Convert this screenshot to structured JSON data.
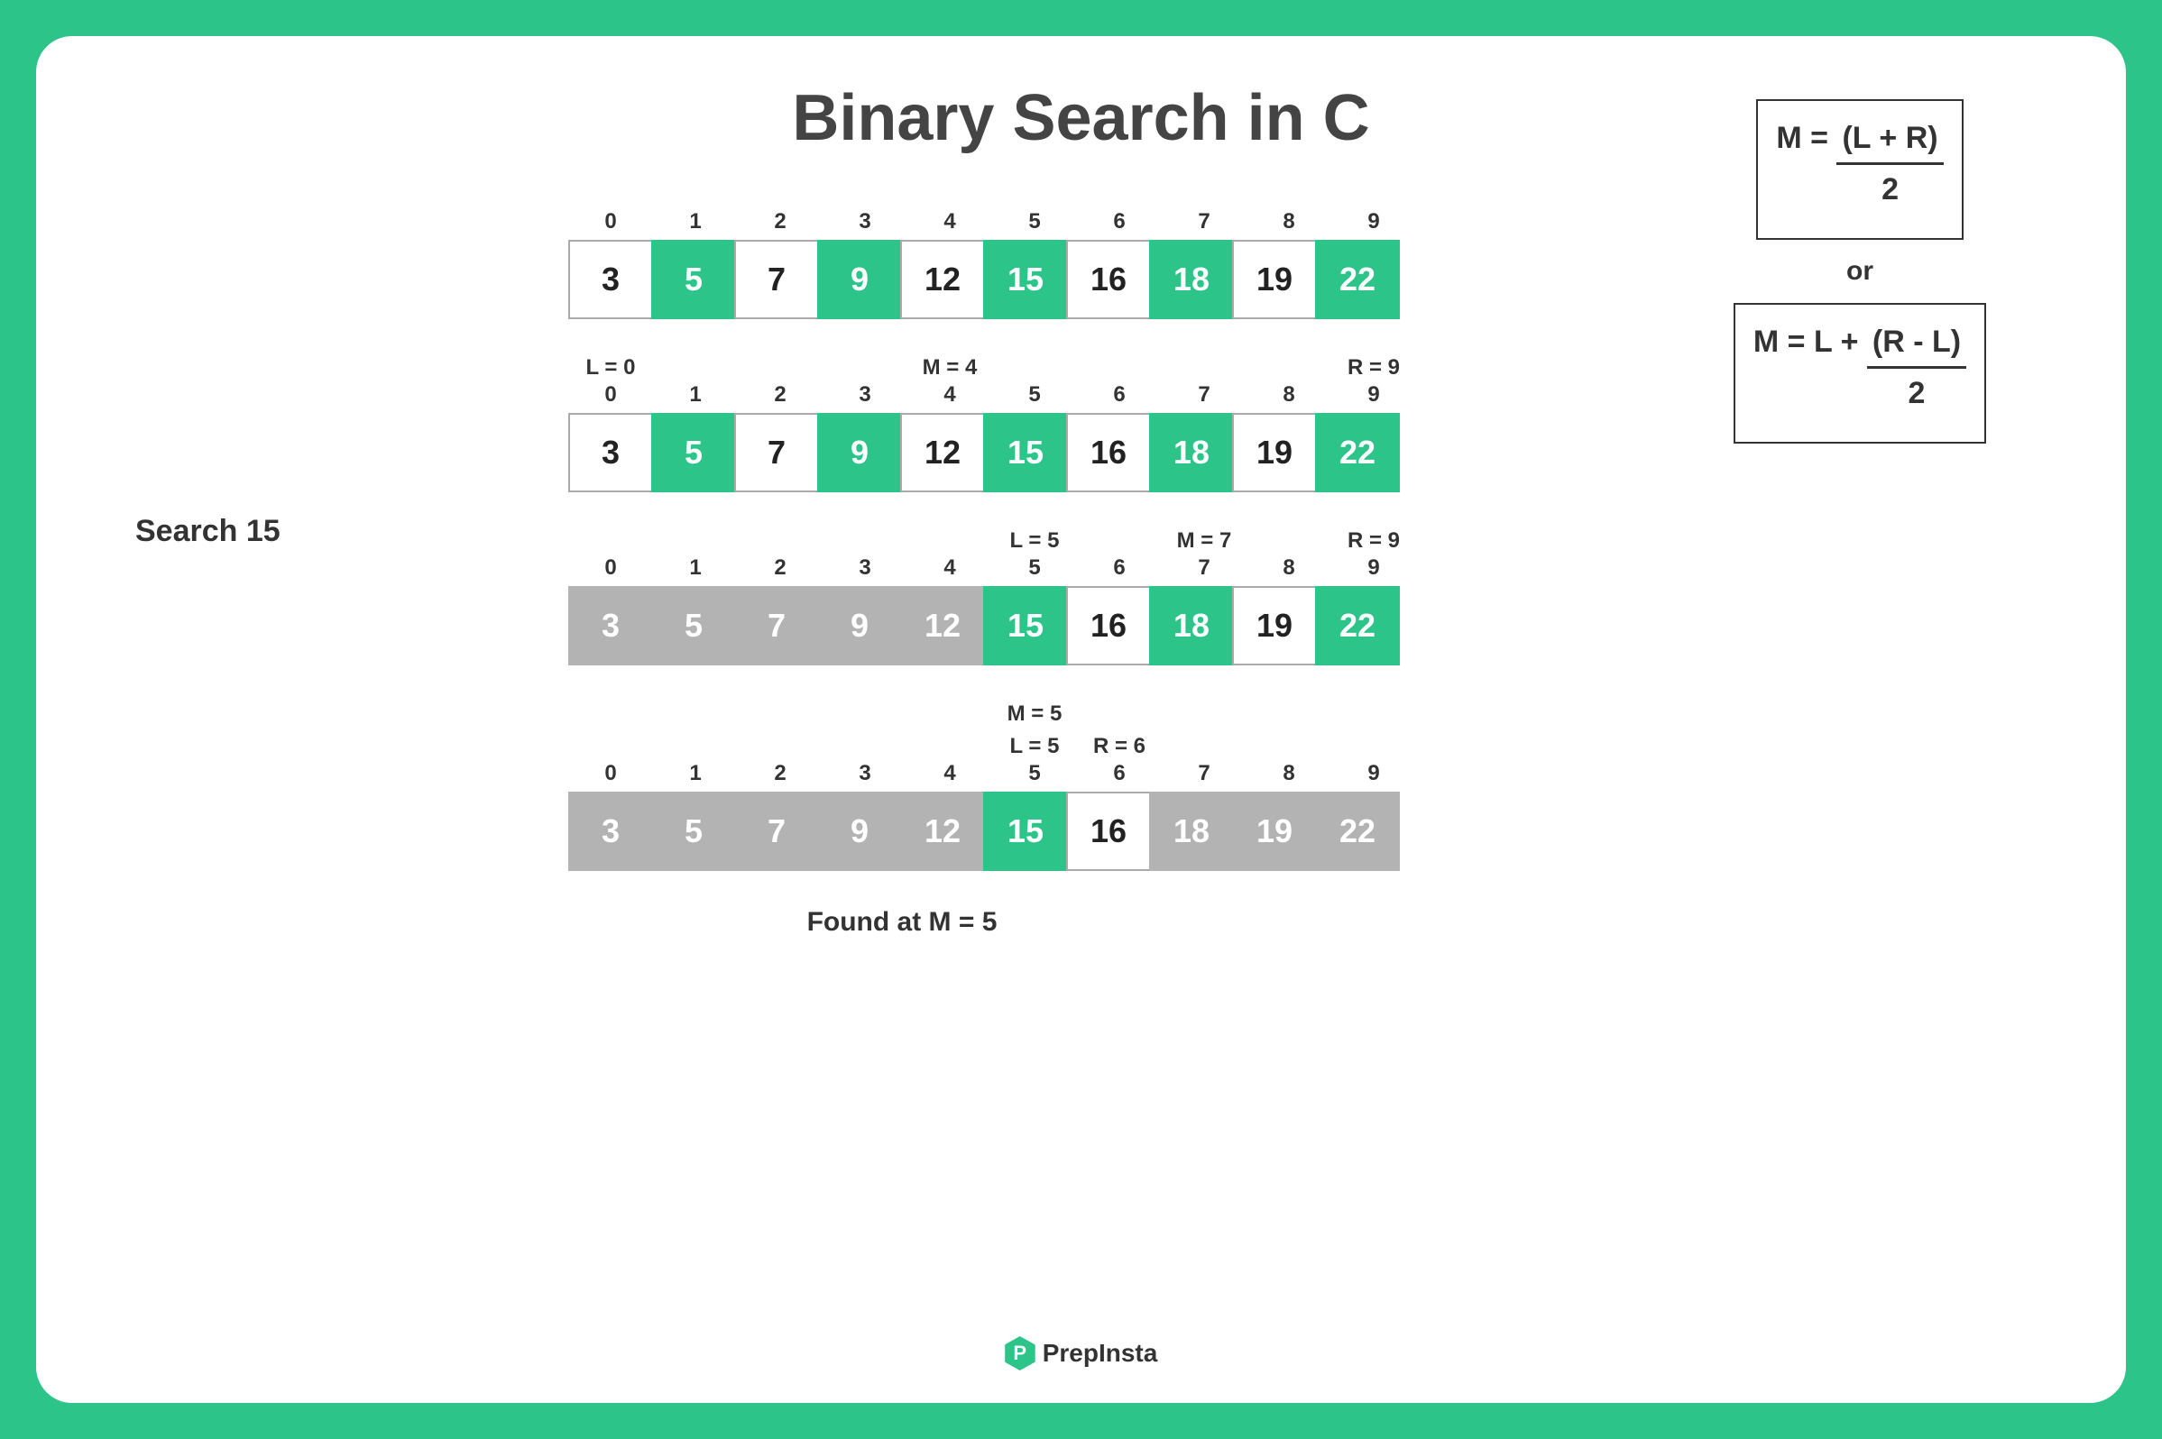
{
  "title": "Binary Search in C",
  "search_label": "Search 15",
  "formula": {
    "f1_lhs": "M = ",
    "f1_num": "(L + R)",
    "f1_den": "2",
    "or": "or",
    "f2_lhs": "M = L + ",
    "f2_num": "(R - L)",
    "f2_den": "2"
  },
  "indices": [
    "0",
    "1",
    "2",
    "3",
    "4",
    "5",
    "6",
    "7",
    "8",
    "9"
  ],
  "values": [
    "3",
    "5",
    "7",
    "9",
    "12",
    "15",
    "16",
    "18",
    "19",
    "22"
  ],
  "steps": [
    {
      "pointers_above": null,
      "pointers_below": null,
      "colors": [
        "white",
        "green",
        "white",
        "green",
        "white",
        "green",
        "white",
        "green",
        "white",
        "green"
      ]
    },
    {
      "pointers_above": [
        "L = 0",
        "",
        "",
        "",
        "M = 4",
        "",
        "",
        "",
        "",
        "R = 9"
      ],
      "pointers_below": null,
      "colors": [
        "white",
        "green",
        "white",
        "green",
        "white",
        "green",
        "white",
        "green",
        "white",
        "green"
      ]
    },
    {
      "pointers_above": [
        "",
        "",
        "",
        "",
        "",
        "L = 5",
        "",
        "M = 7",
        "",
        "R = 9"
      ],
      "pointers_below": null,
      "colors": [
        "gray",
        "gray",
        "gray",
        "gray",
        "gray",
        "green",
        "white",
        "green",
        "white",
        "green"
      ]
    },
    {
      "pointers_above_top": [
        "",
        "",
        "",
        "",
        "",
        "M = 5",
        "",
        "",
        "",
        ""
      ],
      "pointers_above_bottom": [
        "",
        "",
        "",
        "",
        "",
        "L = 5",
        "R = 6",
        "",
        "",
        ""
      ],
      "pointers_below": null,
      "colors": [
        "gray",
        "gray",
        "gray",
        "gray",
        "gray",
        "green",
        "white",
        "gray",
        "gray",
        "gray"
      ]
    }
  ],
  "found_label": "Found at M = 5",
  "brand": "PrepInsta",
  "brand_initial": "P"
}
